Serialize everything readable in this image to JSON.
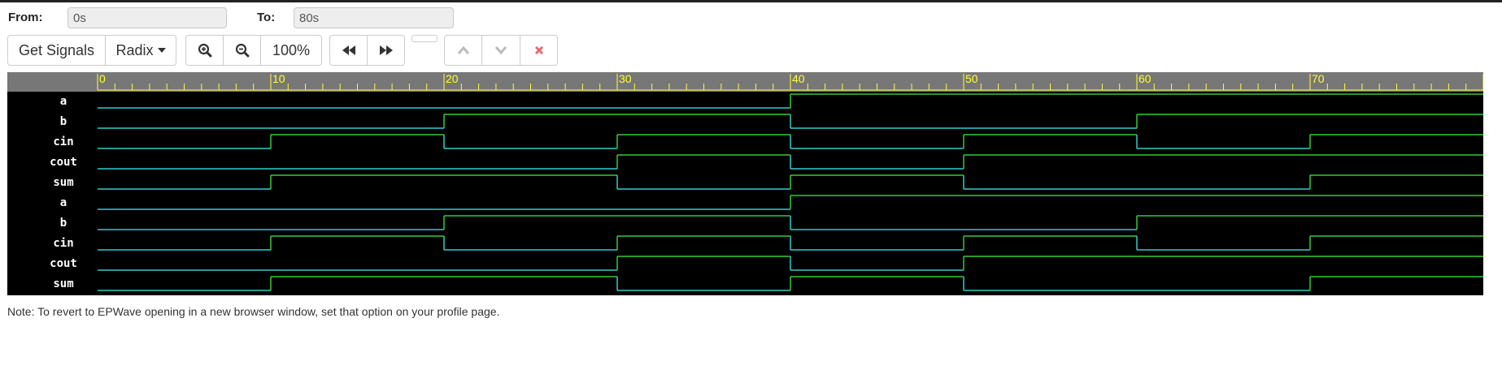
{
  "range": {
    "from_label": "From:",
    "from_value": "0s",
    "to_label": "To:",
    "to_value": "80s"
  },
  "toolbar": {
    "get_signals_label": "Get Signals",
    "radix_label": "Radix",
    "zoom_level": "100%",
    "icons": [
      "zoom-in-icon",
      "zoom-out-icon",
      "rewind-icon",
      "fast-forward-icon",
      "chevron-up-icon",
      "chevron-down-icon",
      "close-icon"
    ]
  },
  "waveform": {
    "time_range": [
      0,
      80
    ],
    "ticks": [
      "0",
      "10",
      "20",
      "30",
      "40",
      "50",
      "60",
      "70"
    ],
    "ruler_background": "#777777",
    "ruler_color": "#ffff33",
    "background": "#000000",
    "low_color": "#33cccc",
    "high_color": "#33cc33",
    "signals": [
      {
        "name": "a",
        "transitions": [
          [
            0,
            0
          ],
          [
            40,
            1
          ]
        ]
      },
      {
        "name": "b",
        "transitions": [
          [
            0,
            0
          ],
          [
            20,
            1
          ],
          [
            40,
            0
          ],
          [
            60,
            1
          ]
        ]
      },
      {
        "name": "cin",
        "transitions": [
          [
            0,
            0
          ],
          [
            10,
            1
          ],
          [
            20,
            0
          ],
          [
            30,
            1
          ],
          [
            40,
            0
          ],
          [
            50,
            1
          ],
          [
            60,
            0
          ],
          [
            70,
            1
          ]
        ]
      },
      {
        "name": "cout",
        "transitions": [
          [
            0,
            0
          ],
          [
            30,
            1
          ],
          [
            40,
            0
          ],
          [
            50,
            1
          ]
        ]
      },
      {
        "name": "sum",
        "transitions": [
          [
            0,
            0
          ],
          [
            10,
            1
          ],
          [
            30,
            0
          ],
          [
            40,
            1
          ],
          [
            50,
            0
          ],
          [
            70,
            1
          ]
        ]
      },
      {
        "name": "a",
        "transitions": [
          [
            0,
            0
          ],
          [
            40,
            1
          ]
        ]
      },
      {
        "name": "b",
        "transitions": [
          [
            0,
            0
          ],
          [
            20,
            1
          ],
          [
            40,
            0
          ],
          [
            60,
            1
          ]
        ]
      },
      {
        "name": "cin",
        "transitions": [
          [
            0,
            0
          ],
          [
            10,
            1
          ],
          [
            20,
            0
          ],
          [
            30,
            1
          ],
          [
            40,
            0
          ],
          [
            50,
            1
          ],
          [
            60,
            0
          ],
          [
            70,
            1
          ]
        ]
      },
      {
        "name": "cout",
        "transitions": [
          [
            0,
            0
          ],
          [
            30,
            1
          ],
          [
            40,
            0
          ],
          [
            50,
            1
          ]
        ]
      },
      {
        "name": "sum",
        "transitions": [
          [
            0,
            0
          ],
          [
            10,
            1
          ],
          [
            30,
            0
          ],
          [
            40,
            1
          ],
          [
            50,
            0
          ],
          [
            70,
            1
          ]
        ]
      }
    ]
  },
  "note": "Note: To revert to EPWave opening in a new browser window, set that option on your profile page."
}
